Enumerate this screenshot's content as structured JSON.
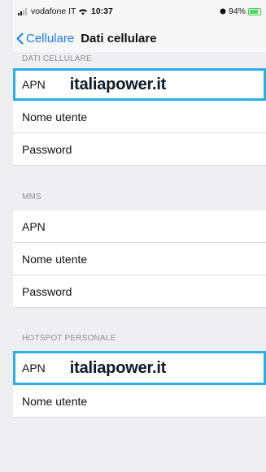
{
  "statusbar": {
    "carrier": "vodafone IT",
    "time": "10:37",
    "battery": "94%"
  },
  "navbar": {
    "back_label": "Cellulare",
    "title": "Dati cellulare"
  },
  "sections": {
    "dati_cellulare": {
      "header": "DATI CELLULARE",
      "apn_label": "APN",
      "apn_value": "italiapower.it",
      "username_label": "Nome utente",
      "password_label": "Password"
    },
    "mms": {
      "header": "MMS",
      "apn_label": "APN",
      "username_label": "Nome utente",
      "password_label": "Password"
    },
    "hotspot": {
      "header": "HOTSPOT PERSONALE",
      "apn_label": "APN",
      "apn_value": "italiapower.it",
      "username_label": "Nome utente"
    }
  },
  "colors": {
    "accent": "#1a7cf5",
    "highlight_border": "#29aee6"
  }
}
